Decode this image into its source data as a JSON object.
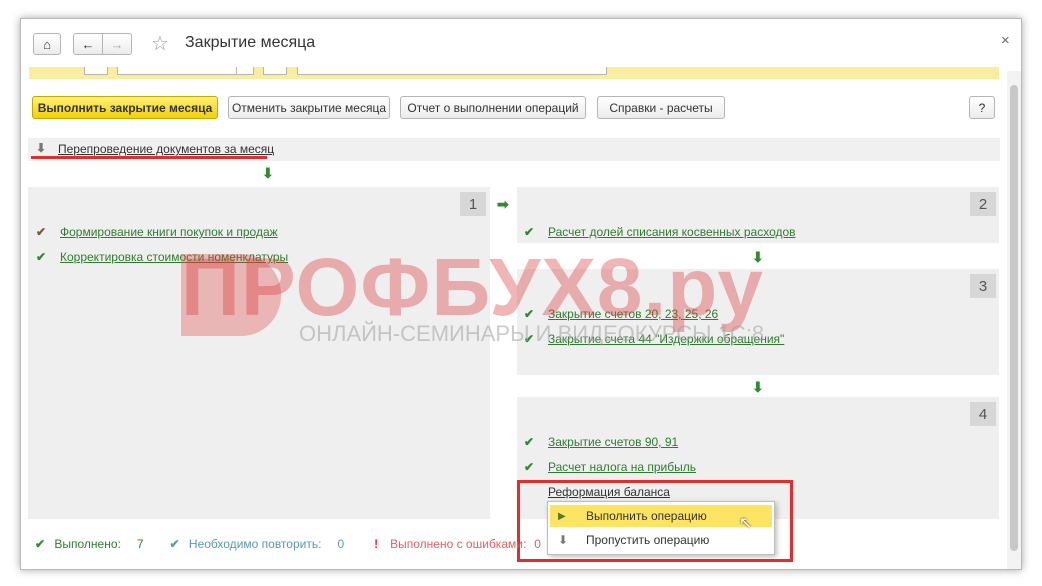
{
  "window": {
    "title": "Закрытие месяца",
    "close_glyph": "×",
    "home_icon": "⌂",
    "back_icon": "←",
    "forward_icon": "→",
    "star_icon": "☆"
  },
  "toolbar": {
    "execute": "Выполнить закрытие месяца",
    "cancel": "Отменить закрытие месяца",
    "report": "Отчет о выполнении операций",
    "info": "Справки - расчеты",
    "help": "?"
  },
  "step0": {
    "icon": "⬇",
    "label": "Перепроведение документов за месяц"
  },
  "panels": {
    "p1": {
      "num": "1",
      "items": [
        {
          "icon": "✔",
          "label": "Формирование книги покупок и продаж"
        },
        {
          "icon": "✔",
          "label": "Корректировка стоимости номенклатуры"
        }
      ]
    },
    "p2": {
      "num": "2",
      "items": [
        {
          "icon": "✔",
          "label": "Расчет долей списания косвенных расходов"
        }
      ]
    },
    "p3": {
      "num": "3",
      "items": [
        {
          "icon": "✔",
          "label": "Закрытие счетов 20, 23, 25, 26"
        },
        {
          "icon": "✔",
          "label": "Закрытие счета 44 \"Издержки обращения\""
        }
      ]
    },
    "p4": {
      "num": "4",
      "items": [
        {
          "icon": "✔",
          "label": "Закрытие счетов 90, 91"
        },
        {
          "icon": "✔",
          "label": "Расчет налога на прибыль"
        },
        {
          "icon": "",
          "label": "Реформация баланса"
        }
      ]
    }
  },
  "arrows": {
    "down": "⬇",
    "right": "➡"
  },
  "context_menu": {
    "run": "Выполнить операцию",
    "skip": "Пропустить операцию",
    "run_icon": "▶",
    "skip_icon": "⬇"
  },
  "status": {
    "done_label": "Выполнено:",
    "done_count": "7",
    "repeat_label": "Необходимо повторить:",
    "repeat_count": "0",
    "errors_label": "Выполнено с ошибками:",
    "errors_count": "0",
    "ok_icon": "✔",
    "err_icon": "!"
  },
  "watermark": {
    "brand": "ПРОФБУХ8.ру",
    "tagline": "ОНЛАЙН-СЕМИНАРЫ И ВИДЕОКУРСЫ 1С:8"
  },
  "colors": {
    "accent_yellow": "#f1d00a",
    "link_green": "#2e7d2e",
    "highlight_red": "#e52c2c",
    "panel_gray": "#efefef"
  }
}
